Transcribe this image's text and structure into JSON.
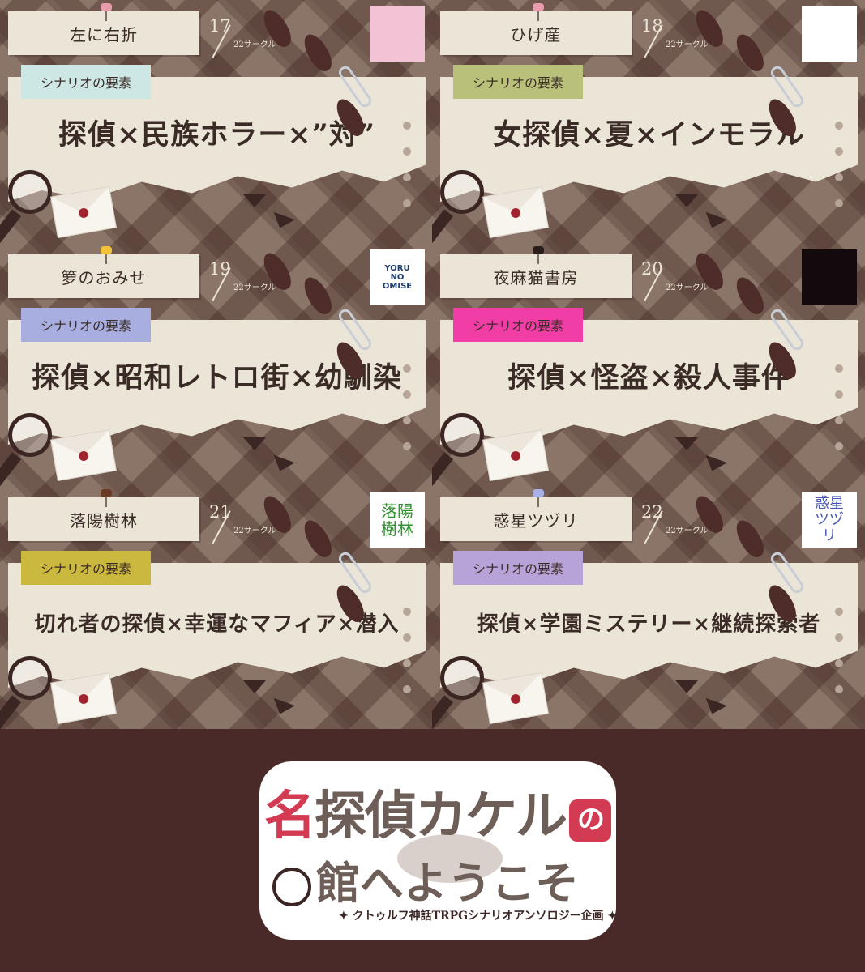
{
  "element_label": "シナリオの要素",
  "cards": [
    {
      "name": "左に右折",
      "num": "17",
      "total": "22サークル",
      "elements": "探偵×民族ホラー×”対”",
      "ribbon": "#cde7e4",
      "pin": "#e89cae",
      "logo": "#f2c3d4",
      "logo_text": ""
    },
    {
      "name": "ひげ産",
      "num": "18",
      "total": "22サークル",
      "elements": "女探偵×夏×インモラル",
      "ribbon": "#b8c07a",
      "pin": "#e89cae",
      "logo": "#ffffff",
      "logo_text": ""
    },
    {
      "name": "箩のおみせ",
      "num": "19",
      "total": "22サークル",
      "elements": "探偵×昭和レトロ街×幼馴染",
      "ribbon": "#a8aee0",
      "pin": "#f2c23a",
      "logo": "#ffffff",
      "logo_text": "YORU NO OMISE"
    },
    {
      "name": "夜麻猫書房",
      "num": "20",
      "total": "22サークル",
      "elements": "探偵×怪盗×殺人事件",
      "ribbon": "#f03ea6",
      "pin": "#2b1d1a",
      "logo": "#120a0d",
      "logo_text": ""
    },
    {
      "name": "落陽樹林",
      "num": "21",
      "total": "22サークル",
      "elements": "切れ者の探偵×幸運なマフィア×潜入",
      "ribbon": "#cbb83e",
      "pin": "#6a3a24",
      "logo": "#ffffff",
      "logo_text": "落陽 樹林"
    },
    {
      "name": "惑星ツヅリ",
      "num": "22",
      "total": "22サークル",
      "elements": "探偵×学園ミステリー×継続探索者",
      "ribbon": "#b8a3d8",
      "pin": "#a8b0e6",
      "logo": "#ffffff",
      "logo_text": "惑星 ツヅリ"
    }
  ],
  "footer": {
    "title_red": "名",
    "title_rest": "探偵カケル",
    "title_no": "の",
    "title_line2": "館へようこそ",
    "subtitle": "✦ クトゥルフ神話TRPGシナリオアンソロジー企画 ✦"
  }
}
